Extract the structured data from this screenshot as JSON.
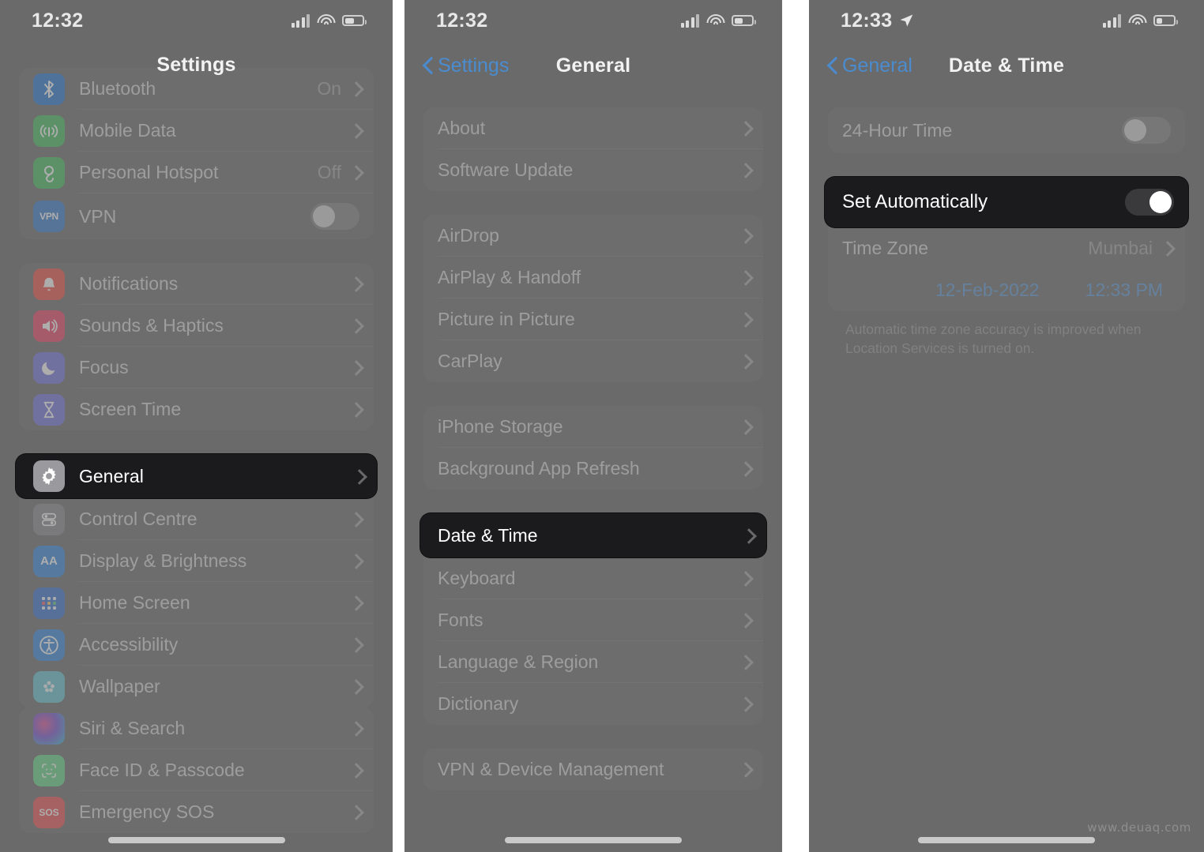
{
  "watermark": "www.deuaq.com",
  "colors": {
    "accent_blue": "#4a8ccf",
    "panel_bg": "#6a6a6a",
    "highlight_bg": "#1b1b1d",
    "date_blue": "#5f9ede"
  },
  "panel1": {
    "status": {
      "time": "12:32",
      "signal_icon": "cellular-bars-icon",
      "wifi_icon": "wifi-icon",
      "battery_icon": "battery-icon"
    },
    "nav": {
      "title": "Settings"
    },
    "groups": [
      {
        "rows": [
          {
            "label": "Bluetooth",
            "value": "On",
            "icon": "bluetooth-icon",
            "icon_class": "g-bt",
            "accessory": "chevron"
          },
          {
            "label": "Mobile Data",
            "value": "",
            "icon": "mobile-data-icon",
            "icon_class": "g-cell",
            "accessory": "chevron"
          },
          {
            "label": "Personal Hotspot",
            "value": "Off",
            "icon": "personal-hotspot-icon",
            "icon_class": "g-hot",
            "accessory": "chevron"
          },
          {
            "label": "VPN",
            "value": "",
            "icon": "vpn-icon",
            "icon_class": "g-vpn",
            "accessory": "toggle",
            "toggle_on": false
          }
        ]
      },
      {
        "rows": [
          {
            "label": "Notifications",
            "value": "",
            "icon": "notifications-icon",
            "icon_class": "g-notif",
            "accessory": "chevron"
          },
          {
            "label": "Sounds & Haptics",
            "value": "",
            "icon": "sounds-haptics-icon",
            "icon_class": "g-sound",
            "accessory": "chevron"
          },
          {
            "label": "Focus",
            "value": "",
            "icon": "focus-moon-icon",
            "icon_class": "g-focus",
            "accessory": "chevron"
          },
          {
            "label": "Screen Time",
            "value": "",
            "icon": "screen-time-hourglass-icon",
            "icon_class": "g-screen",
            "accessory": "chevron"
          }
        ]
      },
      {
        "rows": [
          {
            "label": "General",
            "value": "",
            "icon": "gear-icon",
            "icon_class": "g-gen",
            "accessory": "chevron",
            "highlight": true
          },
          {
            "label": "Control Centre",
            "value": "",
            "icon": "control-centre-icon",
            "icon_class": "g-cc",
            "accessory": "chevron"
          },
          {
            "label": "Display & Brightness",
            "value": "",
            "icon": "display-brightness-icon",
            "icon_class": "g-disp",
            "accessory": "chevron"
          },
          {
            "label": "Home Screen",
            "value": "",
            "icon": "home-screen-icon",
            "icon_class": "g-home",
            "accessory": "chevron"
          },
          {
            "label": "Accessibility",
            "value": "",
            "icon": "accessibility-icon",
            "icon_class": "g-acc",
            "accessory": "chevron"
          },
          {
            "label": "Wallpaper",
            "value": "",
            "icon": "wallpaper-icon",
            "icon_class": "g-wall",
            "accessory": "chevron"
          },
          {
            "label": "Siri & Search",
            "value": "",
            "icon": "siri-search-icon",
            "icon_class": "g-siri",
            "accessory": "chevron"
          },
          {
            "label": "Face ID & Passcode",
            "value": "",
            "icon": "face-id-icon",
            "icon_class": "g-face",
            "accessory": "chevron"
          },
          {
            "label": "Emergency SOS",
            "value": "",
            "icon": "emergency-sos-icon",
            "icon_class": "g-sos",
            "accessory": "chevron"
          }
        ]
      }
    ]
  },
  "panel2": {
    "status": {
      "time": "12:32"
    },
    "nav": {
      "back_label": "Settings",
      "title": "General"
    },
    "groups": [
      {
        "rows": [
          {
            "label": "About",
            "accessory": "chevron"
          },
          {
            "label": "Software Update",
            "accessory": "chevron"
          }
        ]
      },
      {
        "rows": [
          {
            "label": "AirDrop",
            "accessory": "chevron"
          },
          {
            "label": "AirPlay & Handoff",
            "accessory": "chevron"
          },
          {
            "label": "Picture in Picture",
            "accessory": "chevron"
          },
          {
            "label": "CarPlay",
            "accessory": "chevron"
          }
        ]
      },
      {
        "rows": [
          {
            "label": "iPhone Storage",
            "accessory": "chevron"
          },
          {
            "label": "Background App Refresh",
            "accessory": "chevron"
          }
        ]
      },
      {
        "rows": [
          {
            "label": "Date & Time",
            "accessory": "chevron",
            "highlight": true
          },
          {
            "label": "Keyboard",
            "accessory": "chevron"
          },
          {
            "label": "Fonts",
            "accessory": "chevron"
          },
          {
            "label": "Language & Region",
            "accessory": "chevron"
          },
          {
            "label": "Dictionary",
            "accessory": "chevron"
          }
        ]
      },
      {
        "rows": [
          {
            "label": "VPN & Device Management",
            "accessory": "chevron"
          }
        ]
      }
    ]
  },
  "panel3": {
    "status": {
      "time": "12:33",
      "location_icon": "location-arrow-icon"
    },
    "nav": {
      "back_label": "General",
      "title": "Date & Time"
    },
    "groups": [
      {
        "rows": [
          {
            "label": "24-Hour Time",
            "accessory": "toggle",
            "toggle_on": false
          }
        ]
      },
      {
        "rows": [
          {
            "label": "Set Automatically",
            "accessory": "toggle",
            "toggle_on": false,
            "highlight": true
          },
          {
            "label": "Time Zone",
            "value": "Mumbai",
            "accessory": "chevron"
          }
        ]
      }
    ],
    "date_row": {
      "date": "12-Feb-2022",
      "time": "12:33 PM"
    },
    "note": "Automatic time zone accuracy is improved when Location Services is turned on."
  }
}
